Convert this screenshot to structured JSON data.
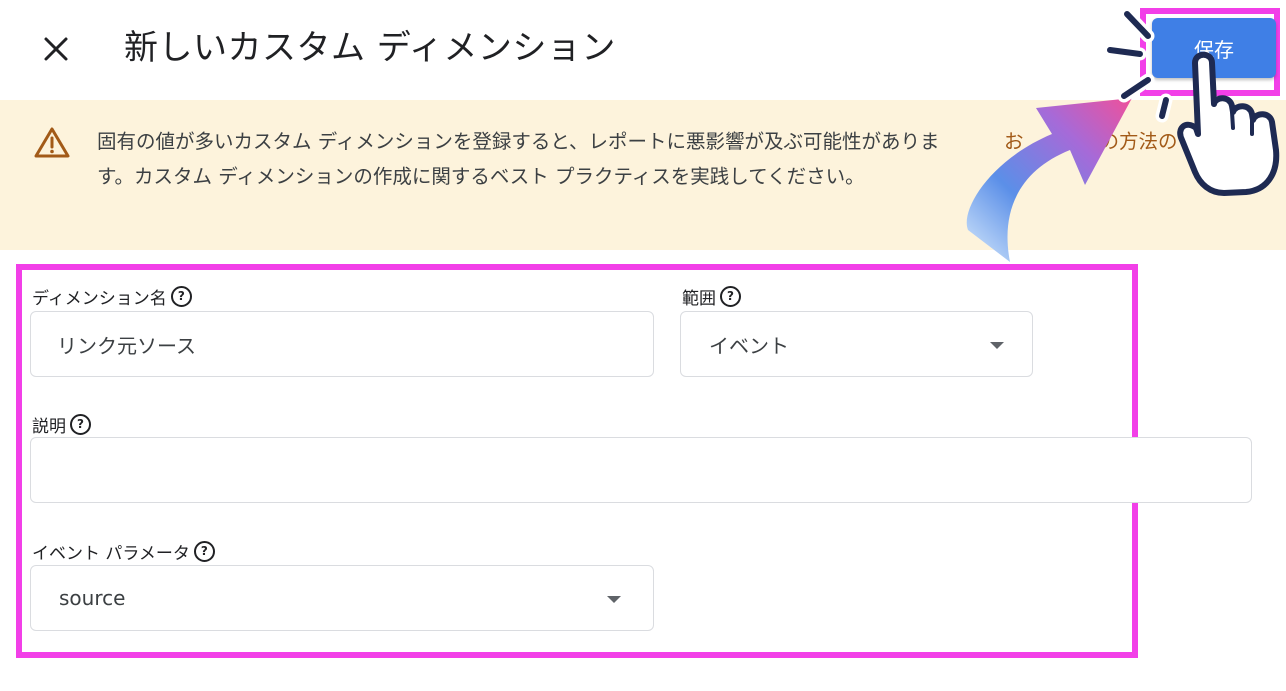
{
  "header": {
    "title": "新しいカスタム ディメンション",
    "close_icon": "close-icon",
    "save_label": "保存"
  },
  "banner": {
    "icon": "warning-icon",
    "text": "固有の値が多いカスタム ディメンションを登録すると、レポートに悪影響が及ぶ可能性があります。カスタム ディメンションの作成に関するベスト プラクティスを実践してください。",
    "link_text": "お",
    "link_tail": "の方法の"
  },
  "form": {
    "dimension_name": {
      "label": "ディメンション名",
      "value": "リンク元ソース"
    },
    "scope": {
      "label": "範囲",
      "value": "イベント"
    },
    "description": {
      "label": "説明",
      "value": ""
    },
    "event_parameter": {
      "label": "イベント パラメータ",
      "value": "source"
    },
    "help_icon": "help-circle-icon"
  },
  "colors": {
    "highlight": "#f23fe8",
    "save_button": "#3f7fe6",
    "banner_bg": "#fdf3dc",
    "warning": "#a25a18"
  }
}
